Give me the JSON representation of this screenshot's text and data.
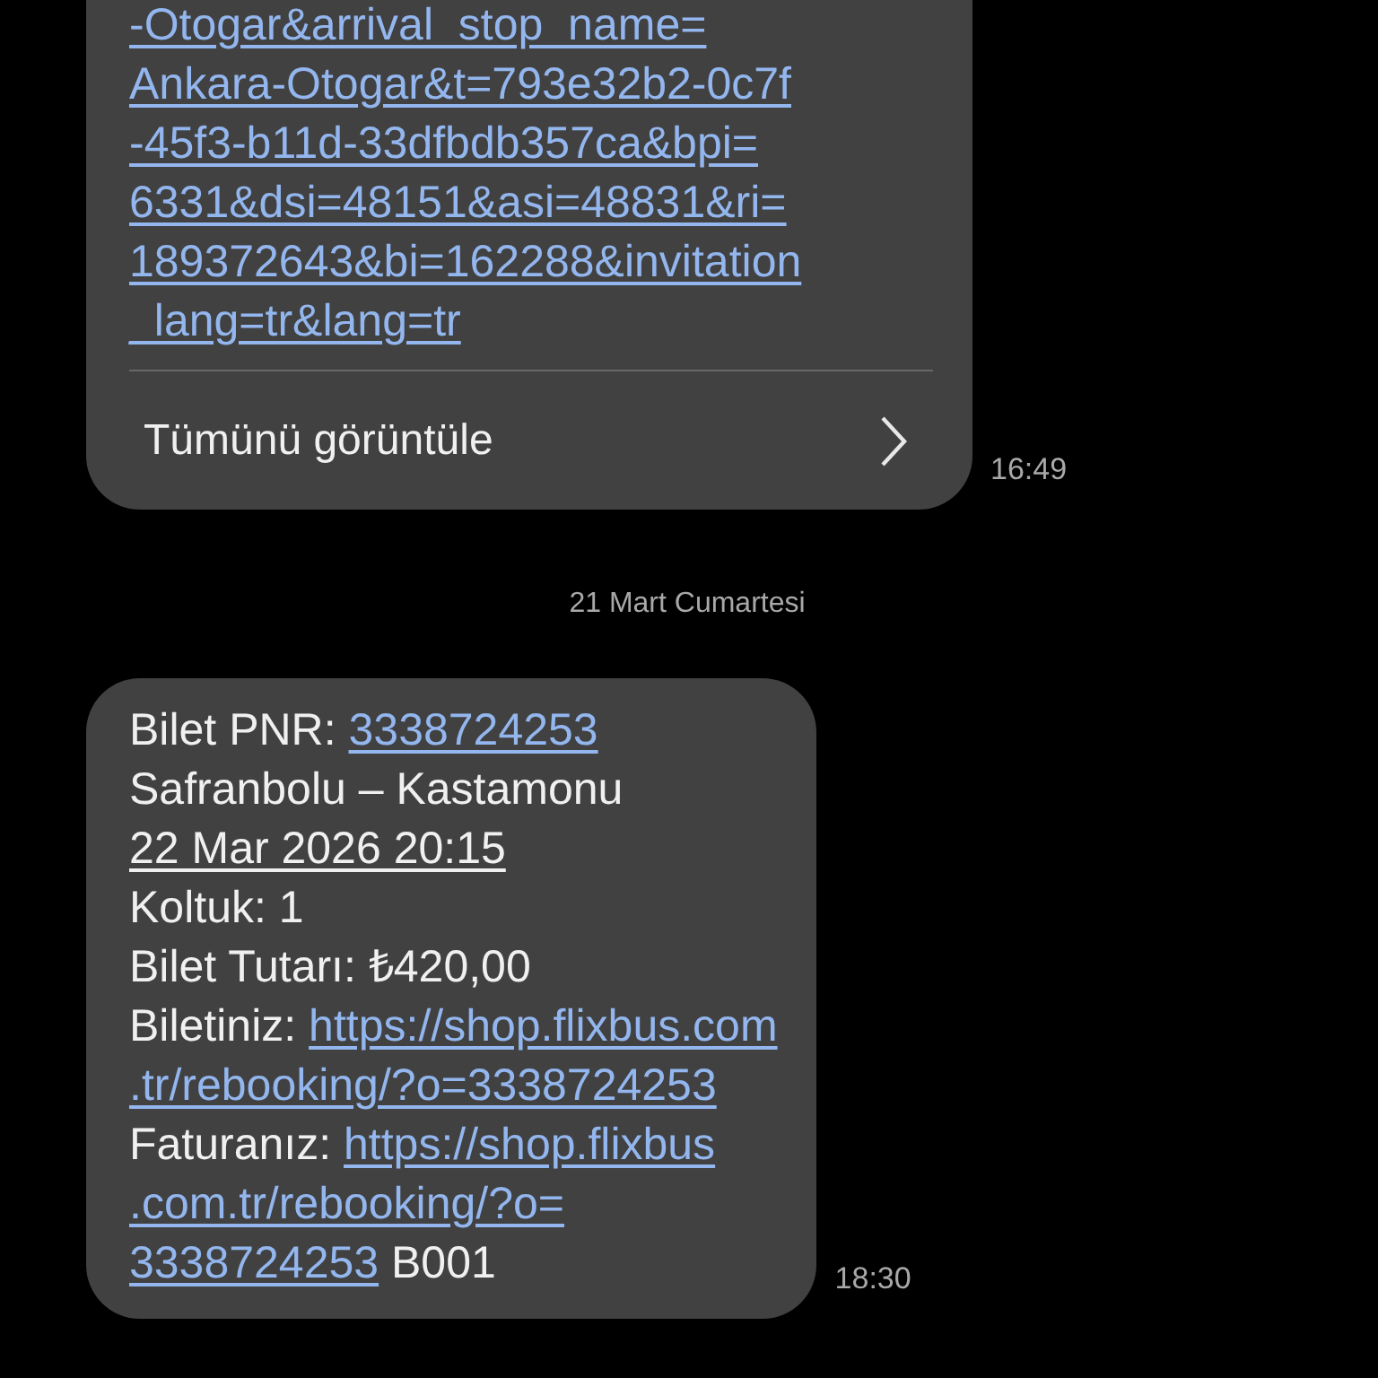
{
  "messages": [
    {
      "lines": [
        [
          {
            "kind": "link",
            "text": "-Otogar&arrival_stop_name="
          }
        ],
        [
          {
            "kind": "link",
            "text": "Ankara-Otogar&t=793e32b2-0c7f"
          }
        ],
        [
          {
            "kind": "link",
            "text": "-45f3-b11d-33dfbdb357ca&bpi="
          }
        ],
        [
          {
            "kind": "link",
            "text": "6331&dsi=48151&asi=48831&ri="
          }
        ],
        [
          {
            "kind": "link",
            "text": "189372643&bi=162288&invitation"
          }
        ],
        [
          {
            "kind": "link",
            "text": "_lang=tr&lang=tr"
          }
        ]
      ],
      "action": "Tümünü görüntüle",
      "time": "16:49",
      "cut_top": true
    },
    {
      "separator": "21 Mart Cumartesi"
    },
    {
      "lines": [
        [
          {
            "kind": "text",
            "text": "Bilet PNR: "
          },
          {
            "kind": "link",
            "text": "3338724253"
          }
        ],
        [
          {
            "kind": "text",
            "text": "Safranbolu – Kastamonu"
          }
        ],
        [
          {
            "kind": "date",
            "text": "22 Mar 2026 20:15"
          }
        ],
        [
          {
            "kind": "text",
            "text": "Koltuk: 1"
          }
        ],
        [
          {
            "kind": "text",
            "text": "Bilet Tutarı: ₺420,00"
          }
        ],
        [
          {
            "kind": "text",
            "text": "Biletiniz: "
          },
          {
            "kind": "link",
            "text": "https://shop.flixbus.com"
          }
        ],
        [
          {
            "kind": "link",
            "text": ".tr/rebooking/?o=3338724253"
          }
        ],
        [
          {
            "kind": "text",
            "text": "Faturanız: "
          },
          {
            "kind": "link",
            "text": "https://shop.flixbus"
          }
        ],
        [
          {
            "kind": "link",
            "text": ".com.tr/rebooking/?o="
          }
        ],
        [
          {
            "kind": "link",
            "text": "3338724253"
          },
          {
            "kind": "text",
            "text": " B001"
          }
        ]
      ],
      "time": "18:30",
      "cut_top": false
    }
  ]
}
